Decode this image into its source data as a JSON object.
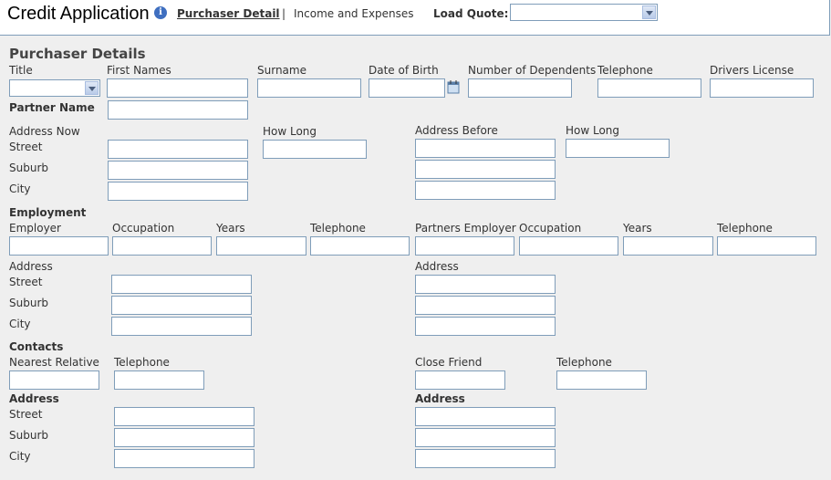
{
  "header": {
    "title": "Credit Application",
    "info_icon": "i",
    "nav_active": "Purchaser Detail",
    "nav_sep": "|",
    "nav_other": "Income and Expenses",
    "load_quote_label": "Load Quote:"
  },
  "purchaser": {
    "heading": "Purchaser Details",
    "labels": {
      "title": "Title",
      "first_names": "First Names",
      "surname": "Surname",
      "dob": "Date of Birth",
      "dependents": "Number of Dependents",
      "telephone": "Telephone",
      "license": "Drivers License",
      "partner_name": "Partner Name"
    }
  },
  "address": {
    "now": "Address Now",
    "how_long": "How Long",
    "before": "Address Before",
    "how_long2": "How Long",
    "street": "Street",
    "suburb": "Suburb",
    "city": "City"
  },
  "employment": {
    "heading": "Employment",
    "employer": "Employer",
    "occupation": "Occupation",
    "years": "Years",
    "telephone": "Telephone",
    "partners_employer": "Partners Employer",
    "occupation2": "Occupation",
    "years2": "Years",
    "telephone2": "Telephone",
    "address": "Address",
    "address2": "Address",
    "street": "Street",
    "suburb": "Suburb",
    "city": "City"
  },
  "contacts": {
    "heading": "Contacts",
    "nearest_relative": "Nearest Relative",
    "telephone": "Telephone",
    "close_friend": "Close Friend",
    "telephone2": "Telephone",
    "address": "Address",
    "address2": "Address",
    "street": "Street",
    "suburb": "Suburb",
    "city": "City"
  }
}
